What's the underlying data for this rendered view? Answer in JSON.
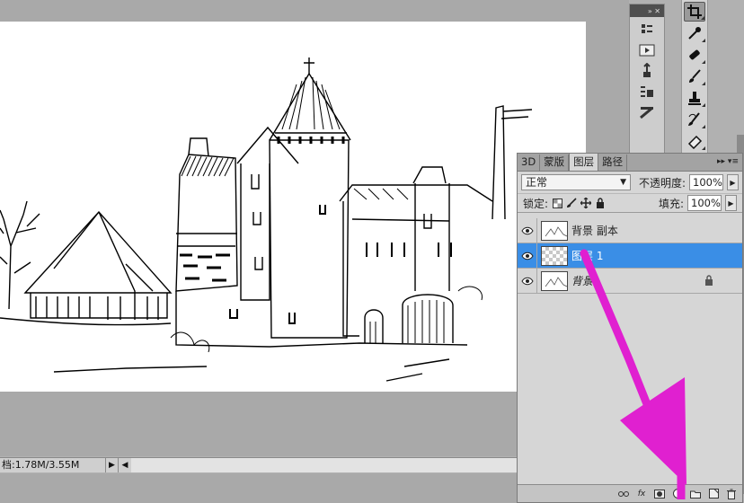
{
  "status_bar": {
    "doc_info": "档:1.78M/3.55M",
    "arrow_glyph": "▶",
    "scroll_left_glyph": "◀"
  },
  "dock": {
    "header_glyphs": "»  ✕",
    "items": [
      "history-icon",
      "actions-icon",
      "brush-presets-icon",
      "clone-source-icon",
      "tool-presets-icon"
    ]
  },
  "toolbar": {
    "tools": [
      "crop-tool-icon",
      "eyedropper-tool-icon",
      "healing-brush-tool-icon",
      "brush-tool-icon",
      "clone-stamp-tool-icon",
      "history-brush-tool-icon",
      "eraser-tool-icon"
    ]
  },
  "layers_panel": {
    "tabs": [
      "3D",
      "蒙版",
      "图层",
      "路径"
    ],
    "active_tab": "图层",
    "tab_controls": "▸▸   ▾≡",
    "blend_mode": "正常",
    "opacity_label": "不透明度:",
    "opacity_value": "100%",
    "lock_label": "锁定:",
    "fill_label": "填充:",
    "fill_value": "100%",
    "layers": [
      {
        "name": "背景 副本",
        "visible": true,
        "selected": false,
        "thumb": "sketch",
        "locked": false
      },
      {
        "name": "图层 1",
        "visible": true,
        "selected": true,
        "thumb": "transparent",
        "locked": false
      },
      {
        "name": "背景",
        "visible": true,
        "selected": false,
        "thumb": "sketch",
        "locked": true
      }
    ]
  },
  "colors": {
    "selected_layer": "#3a8ee6",
    "annotation_arrow": "#e020d0",
    "workspace": "#a9a9a9"
  }
}
